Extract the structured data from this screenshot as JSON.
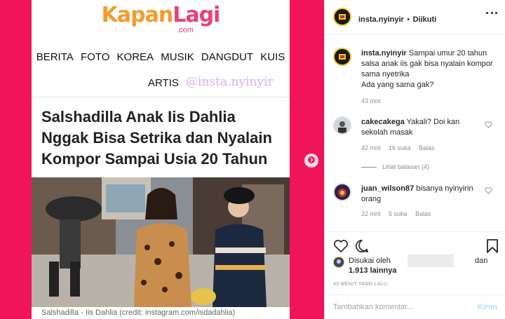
{
  "article": {
    "logo_part1": "Kapan",
    "logo_part2": "Lagi",
    "logo_domain": ".com",
    "nav_items": [
      "BERITA",
      "FOTO",
      "KOREA",
      "MUSIK",
      "DANGDUT",
      "KUIS"
    ],
    "nav_item_last": "ARTIS",
    "watermark": "@insta.nyinyir",
    "headline": "Salshadilla Anak Iis Dahlia Nggak Bisa Setrika dan Nyalain Kompor Sampai Usia 20 Tahun",
    "caption": "Salshadilla - Iis Dahlia (credit: instagram.com/isdadahlia)"
  },
  "post": {
    "username": "insta.nyinyir",
    "separator": "•",
    "follow_status": "Diikuti",
    "caption_user": "insta.nyinyir",
    "caption_text": "Sampai umur 20 tahun salsa anak iis gak bisa nyalain kompor sama nyetrika",
    "caption_text2": "Ada yang sama gak?",
    "caption_time": "43 mnt"
  },
  "comments": [
    {
      "user": "cakecakega",
      "text": "Yakali? Doi kan sekolah masak",
      "time": "42 mnt",
      "likes": "16 suka",
      "reply": "Balas",
      "view_replies": "Lihat balasan (4)"
    },
    {
      "user": "juan_wilson87",
      "text": "bisanya nyinyirin orang",
      "time": "22 mnt",
      "likes": "5 suka",
      "reply": "Balas"
    }
  ],
  "likes_line": {
    "prefix": "Disukai oleh",
    "connector": "dan",
    "others": "1.913 lainnya"
  },
  "timestamp": "43 MENIT YANG LALU",
  "add_comment": {
    "placeholder": "Tambahkan komentar...",
    "send_label": "Kirim"
  },
  "colors": {
    "background_pink": "#f0145a",
    "send_disabled": "#b2dffc"
  }
}
